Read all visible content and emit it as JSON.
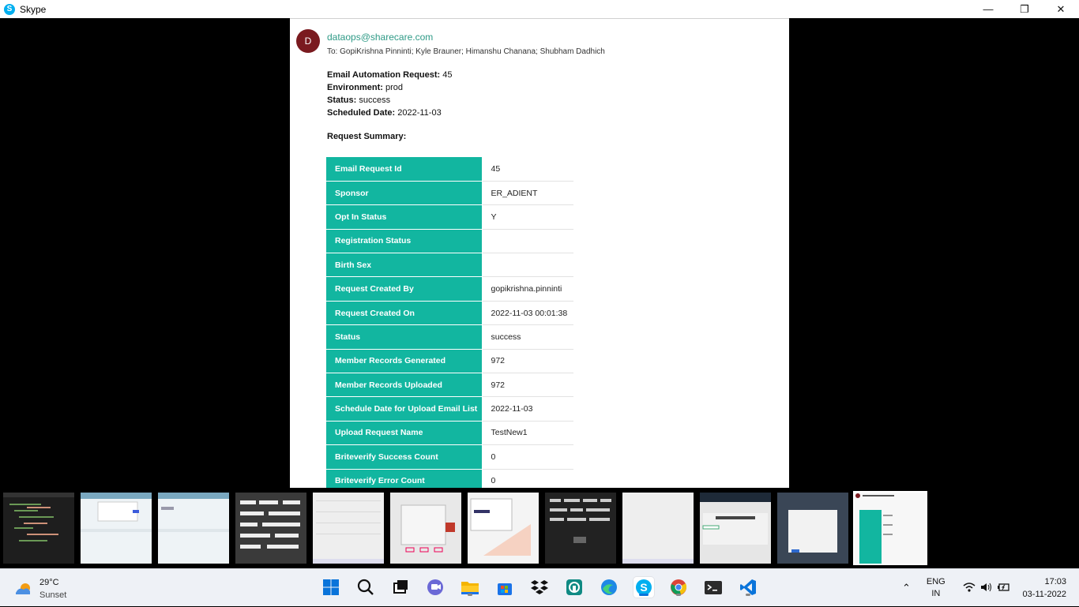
{
  "window": {
    "title": "Skype",
    "app_icon_letter": "S",
    "minimize": "—",
    "maximize": "❐",
    "close": "✕"
  },
  "email": {
    "avatar_letter": "D",
    "from": "dataops@sharecare.com",
    "to": "To:  GopiKrishna Pinninti;  Kyle Brauner;  Himanshu Chanana;  Shubham Dadhich",
    "meta": [
      {
        "label": "Email Automation Request:",
        "value": "45"
      },
      {
        "label": "Environment:",
        "value": "prod"
      },
      {
        "label": "Status:",
        "value": "success"
      },
      {
        "label": "Scheduled Date:",
        "value": "2022-11-03"
      }
    ],
    "summary_title": "Request Summary:",
    "rows": [
      {
        "key": "Email Request Id",
        "value": "45"
      },
      {
        "key": "Sponsor",
        "value": "ER_ADIENT"
      },
      {
        "key": "Opt In Status",
        "value": "Y"
      },
      {
        "key": "Registration Status",
        "value": ""
      },
      {
        "key": "Birth Sex",
        "value": ""
      },
      {
        "key": "Request Created By",
        "value": "gopikrishna.pinninti"
      },
      {
        "key": "Request Created On",
        "value": "2022-11-03 00:01:38"
      },
      {
        "key": "Status",
        "value": "success"
      },
      {
        "key": "Member Records Generated",
        "value": "972"
      },
      {
        "key": "Member Records Uploaded",
        "value": "972"
      },
      {
        "key": "Schedule Date for Upload Email List",
        "value": "2022-11-03"
      },
      {
        "key": "Upload Request Name",
        "value": "TestNew1"
      },
      {
        "key": "Briteverify Success Count",
        "value": "0"
      },
      {
        "key": "Briteverify Error Count",
        "value": "0"
      }
    ]
  },
  "taskbar": {
    "weather_temp": "29°C",
    "weather_desc": "Sunset",
    "lang_top": "ENG",
    "lang_bottom": "IN",
    "time": "17:03",
    "date": "03-11-2022"
  },
  "colors": {
    "accent_teal": "#12b6a0",
    "avatar": "#7a1a1f",
    "skype_blue": "#00aff0"
  }
}
